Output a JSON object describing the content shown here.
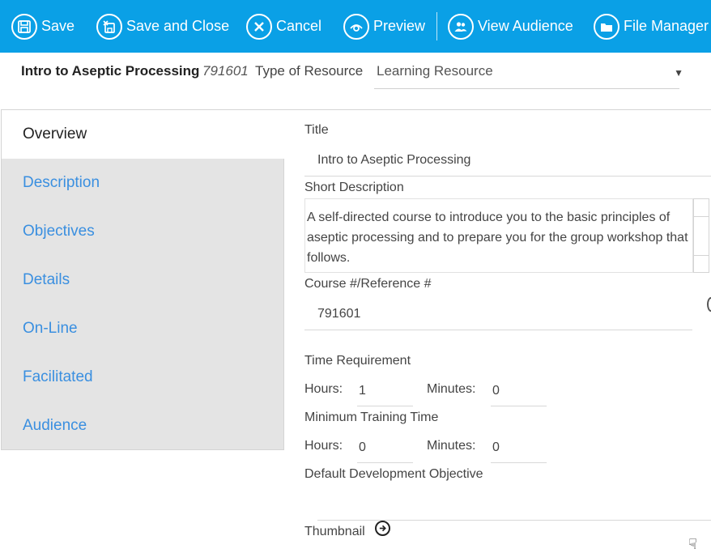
{
  "toolbar": {
    "save": "Save",
    "save_close": "Save and Close",
    "cancel": "Cancel",
    "preview": "Preview",
    "view_audience": "View Audience",
    "file_manager": "File Manager"
  },
  "header": {
    "course_name": "Intro to Aseptic Processing",
    "course_code": "791601",
    "type_label": "Type of Resource",
    "type_value": "Learning Resource"
  },
  "tabs": [
    "Overview",
    "Description",
    "Objectives",
    "Details",
    "On-Line",
    "Facilitated",
    "Audience"
  ],
  "form": {
    "title_label": "Title",
    "title_value": "Intro to Aseptic Processing",
    "short_desc_label": "Short Description",
    "short_desc_value": "A self-directed course to introduce you to the basic principles of aseptic processing and to prepare you for the group workshop that follows.",
    "course_ref_label": "Course #/Reference #",
    "course_ref_value": "791601",
    "time_req_label": "Time Requirement",
    "hours_label": "Hours:",
    "minutes_label": "Minutes:",
    "time_hours": "1",
    "time_minutes": "0",
    "min_training_label": "Minimum Training Time",
    "min_hours": "0",
    "min_minutes": "0",
    "default_dev_label": "Default Development Objective",
    "thumbnail_label": "Thumbnail"
  }
}
